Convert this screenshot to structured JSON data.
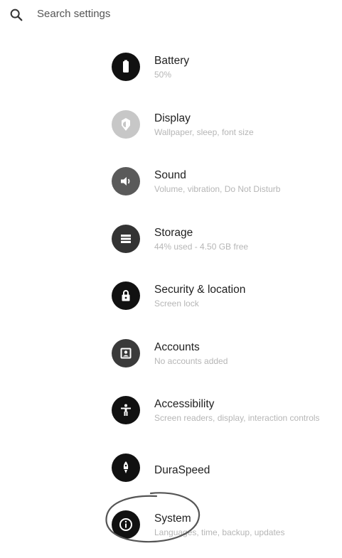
{
  "search": {
    "placeholder": "Search settings",
    "icon": "search-icon"
  },
  "items": [
    {
      "title": "Battery",
      "subtitle": "50%",
      "icon": "battery-icon",
      "color": "#111111"
    },
    {
      "title": "Display",
      "subtitle": "Wallpaper, sleep, font size",
      "icon": "brightness-icon",
      "color": "#c7c7c7"
    },
    {
      "title": "Sound",
      "subtitle": "Volume, vibration, Do Not Disturb",
      "icon": "volume-icon",
      "color": "#5a5a5a"
    },
    {
      "title": "Storage",
      "subtitle": "44% used - 4.50 GB free",
      "icon": "storage-icon",
      "color": "#333333"
    },
    {
      "title": "Security & location",
      "subtitle": "Screen lock",
      "icon": "lock-icon",
      "color": "#111111"
    },
    {
      "title": "Accounts",
      "subtitle": "No accounts added",
      "icon": "account-icon",
      "color": "#3a3a3a"
    },
    {
      "title": "Accessibility",
      "subtitle": "Screen readers, display, interaction controls",
      "icon": "accessibility-icon",
      "color": "#111111"
    },
    {
      "title": "DuraSpeed",
      "subtitle": "",
      "icon": "rocket-icon",
      "color": "#111111"
    },
    {
      "title": "System",
      "subtitle": "Languages, time, backup, updates",
      "icon": "info-icon",
      "color": "#111111"
    }
  ]
}
